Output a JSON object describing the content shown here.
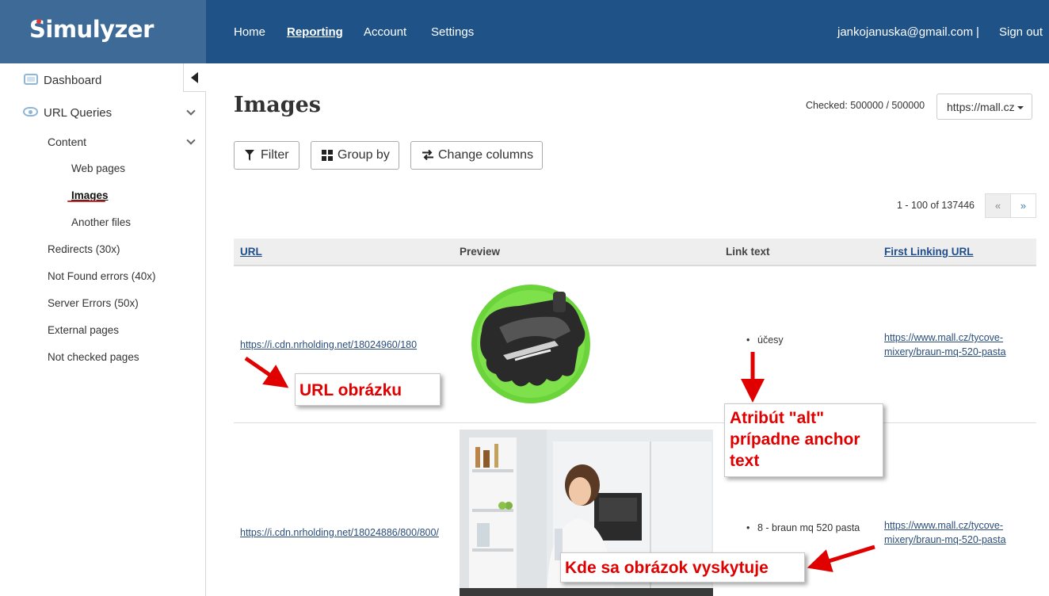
{
  "header": {
    "logo": "Simulyzer",
    "nav": [
      {
        "label": "Home",
        "active": false
      },
      {
        "label": "Reporting",
        "active": true
      },
      {
        "label": "Account",
        "active": false
      },
      {
        "label": "Settings",
        "active": false
      }
    ],
    "user_email": "jankojanuska@gmail.com",
    "separator": "|",
    "signout": "Sign out"
  },
  "sidebar": {
    "dashboard": "Dashboard",
    "url_queries": "URL Queries",
    "content": "Content",
    "content_items": [
      "Web pages",
      "Images",
      "Another files"
    ],
    "other_items": [
      "Redirects (30x)",
      "Not Found errors (40x)",
      "Server Errors (50x)",
      "External pages",
      "Not checked pages"
    ]
  },
  "main": {
    "title": "Images",
    "checked_label": "Checked:",
    "checked_value": "500000 / 500000",
    "site_select": "https://mall.cz",
    "buttons": {
      "filter": "Filter",
      "group_by": "Group by",
      "change_columns": "Change columns"
    },
    "pager": {
      "summary": "1 - 100 of 137446",
      "prev": "«",
      "next": "»"
    }
  },
  "table": {
    "columns": [
      "URL",
      "Preview",
      "Link text",
      "First Linking URL"
    ],
    "rows": [
      {
        "url": "https://i.cdn.nrholding.net/18024960/180",
        "link_text": "účesy",
        "first_linking_url_line1": "https://www.mall.cz/tycove-",
        "first_linking_url_line2": "mixery/braun-mq-520-pasta"
      },
      {
        "url": "https://i.cdn.nrholding.net/18024886/800/800/",
        "link_text": "8 - braun mq 520 pasta",
        "first_linking_url_line1": "https://www.mall.cz/tycove-",
        "first_linking_url_line2": "mixery/braun-mq-520-pasta"
      }
    ]
  },
  "annotations": {
    "url_label": "URL obrázku",
    "alt_line1": "Atribút \"alt\"",
    "alt_line2": "prípadne anchor",
    "alt_line3": "text",
    "location_label": "Kde sa obrázok vyskytuje"
  },
  "colors": {
    "header": "#1f5286",
    "logo_box": "#3d6a97",
    "annotation": "#e00000",
    "link": "#2a4d7a"
  }
}
